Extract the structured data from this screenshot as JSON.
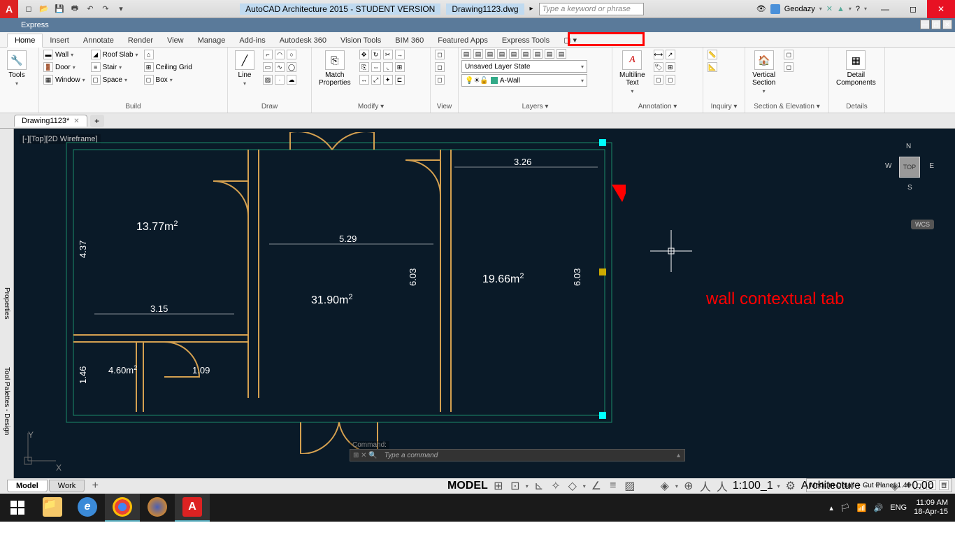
{
  "titlebar": {
    "app_title": "AutoCAD Architecture 2015 - STUDENT VERSION",
    "filename": "Drawing1123.dwg",
    "search_placeholder": "Type a keyword or phrase",
    "username": "Geodazy"
  },
  "express_bar": {
    "label": "Express"
  },
  "ribbon_tabs": [
    "Home",
    "Insert",
    "Annotate",
    "Render",
    "View",
    "Manage",
    "Add-ins",
    "Autodesk 360",
    "Vision Tools",
    "BIM 360",
    "Featured Apps",
    "Express Tools"
  ],
  "ribbon": {
    "tools": {
      "label": "Tools"
    },
    "build": {
      "label": "Build",
      "items": {
        "wall": "Wall",
        "door": "Door",
        "window": "Window",
        "roofslab": "Roof Slab",
        "stair": "Stair",
        "space": "Space",
        "ceiling": "Ceiling Grid",
        "box": "Box"
      }
    },
    "draw": {
      "label": "Draw",
      "line": "Line"
    },
    "modify": {
      "label": "Modify ▾",
      "match": "Match\nProperties"
    },
    "view": {
      "label": "View"
    },
    "layers": {
      "label": "Layers ▾",
      "state": "Unsaved Layer State",
      "current": "A-Wall"
    },
    "annotation": {
      "label": "Annotation ▾",
      "mtext": "Multiline\nText"
    },
    "inquiry": {
      "label": "Inquiry ▾"
    },
    "section": {
      "label": "Section & Elevation ▾",
      "vsec": "Vertical\nSection"
    },
    "details": {
      "label": "Details",
      "comp": "Detail\nComponents"
    }
  },
  "file_tab": {
    "name": "Drawing1123*"
  },
  "canvas": {
    "view_label": "[-][Top][2D Wireframe]",
    "viewcube_top": "TOP",
    "wcs": "WCS",
    "compass": {
      "n": "N",
      "s": "S",
      "e": "E",
      "w": "W"
    },
    "ucs": {
      "x": "X",
      "y": "Y"
    },
    "dims": {
      "d1": "3.26",
      "d2": "5.29",
      "d3": "3.15",
      "d4": "1.09",
      "d5": "4.37",
      "d6": "6.03",
      "d7": "6.03",
      "d8": "1.46"
    },
    "areas": {
      "a1": "13.77m",
      "a2": "31.90m",
      "a3": "19.66m",
      "a4": "4.60m",
      "sq": "2"
    },
    "cmd_hist": "Command:",
    "cmd_placeholder": "Type a command"
  },
  "side_palettes": {
    "props": "Properties",
    "tools": "Tool Palettes - Design"
  },
  "annotation_text": "wall contextual tab",
  "model_tabs": [
    "Model",
    "Work"
  ],
  "status": {
    "model": "MODEL",
    "scale": "1:100_1",
    "ws": "Architecture",
    "elev": "+0.00",
    "detail": "Medium Detail",
    "cutplane": "Cut Plane:  1.40"
  },
  "taskbar": {
    "lang": "ENG",
    "time": "11:09 AM",
    "date": "18-Apr-15"
  }
}
